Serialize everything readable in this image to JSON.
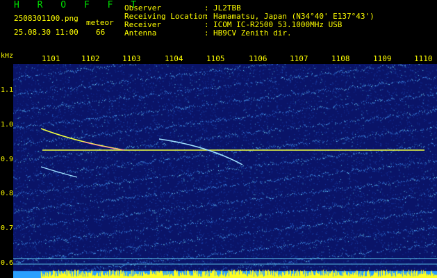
{
  "header": {
    "brand": "H R O F F T",
    "filename": "2508301100.png",
    "mode": "meteor",
    "timestamp": "25.08.30 11:00",
    "count": "66",
    "fields": [
      {
        "label": "Observer",
        "value": "JL2TBB"
      },
      {
        "label": "Receiving Location",
        "value": "Hamamatsu, Japan (N34°40' E137°43')"
      },
      {
        "label": "Receiver",
        "value": "ICOM IC-R2500 53.1000MHz USB"
      },
      {
        "label": "Antenna",
        "value": "HB9CV Zenith dir."
      }
    ]
  },
  "axes": {
    "y_unit": "kHz",
    "x_ticks": [
      "1101",
      "1102",
      "1103",
      "1104",
      "1105",
      "1106",
      "1107",
      "1108",
      "1109",
      "1110"
    ],
    "y_ticks": [
      "1.1",
      "1.0",
      "0.9",
      "0.8",
      "0.7",
      "0.6"
    ]
  },
  "colors": {
    "text": "#ffff00",
    "brand": "#00e000",
    "background": "#0a1468",
    "carrier": "#f0ff40",
    "echo": "#ff60c0"
  }
}
